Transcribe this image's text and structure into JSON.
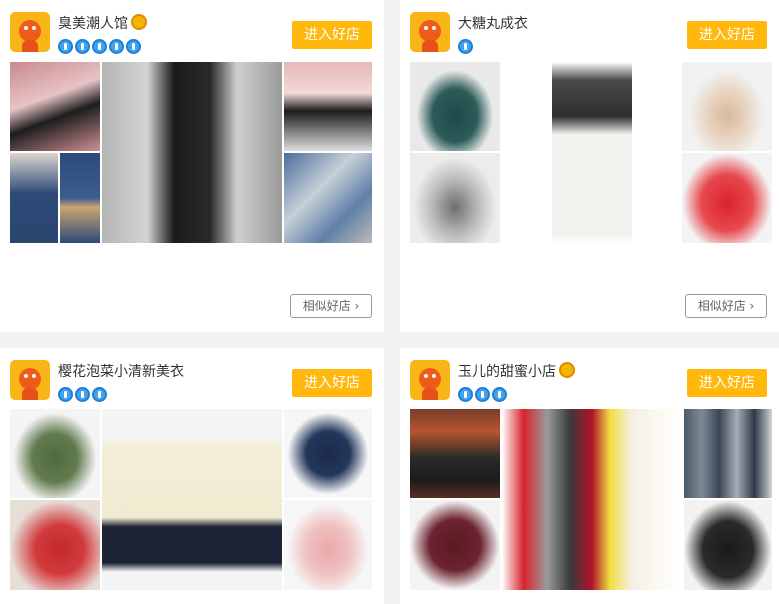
{
  "shops": [
    {
      "name": "臭美潮人馆",
      "has_crown": true,
      "badge_count": 5,
      "enter_label": "进入好店",
      "similar_label": "相似好店 ›"
    },
    {
      "name": "大糖丸成衣",
      "has_crown": false,
      "badge_count": 1,
      "enter_label": "进入好店",
      "similar_label": "相似好店 ›"
    },
    {
      "name": "樱花泡菜小清新美衣",
      "has_crown": false,
      "badge_count": 3,
      "enter_label": "进入好店"
    },
    {
      "name": "玉儿的甜蜜小店",
      "has_crown": true,
      "badge_count": 3,
      "enter_label": "进入好店"
    }
  ],
  "colors": {
    "accent": "#ffb80b",
    "badge": "#3fa3f0"
  }
}
